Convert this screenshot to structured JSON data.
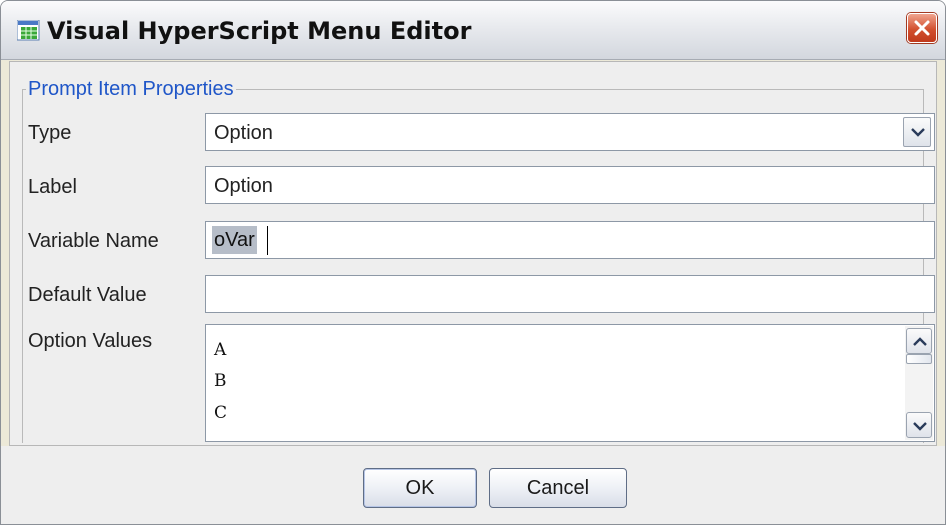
{
  "window": {
    "title": "Visual HyperScript Menu Editor",
    "app_icon": "spreadsheet-grid-icon",
    "close_icon": "close-x-icon"
  },
  "group": {
    "title": "Prompt Item Properties"
  },
  "form": {
    "type": {
      "label": "Type",
      "value": "Option"
    },
    "label": {
      "label": "Label",
      "value": "Option"
    },
    "variable_name": {
      "label": "Variable Name",
      "value": "oVar"
    },
    "default_value": {
      "label": "Default Value",
      "value": ""
    },
    "option_values": {
      "label": "Option Values",
      "lines": [
        "A",
        "B",
        "C"
      ]
    }
  },
  "buttons": {
    "ok": "OK",
    "cancel": "Cancel"
  },
  "colors": {
    "group_title": "#1f56c8",
    "selection": "#b6bdc8",
    "close_button": "#d2502f"
  }
}
